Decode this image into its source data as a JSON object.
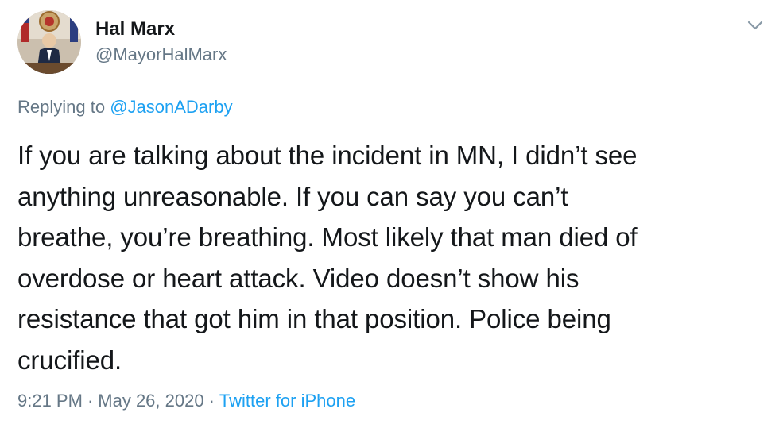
{
  "tweet": {
    "author": {
      "display_name": "Hal Marx",
      "handle": "@MayorHalMarx",
      "avatar_icon": "profile-photo"
    },
    "replying_to": {
      "prefix": "Replying to ",
      "handle": "@JasonADarby"
    },
    "text": "If you are talking about the incident in MN, I didn’t see\nanything unreasonable. If you can say you can’t\nbreathe, you’re breathing. Most likely that man died of\noverdose or heart attack. Video doesn’t show his\nresistance that got him in that position. Police being\ncrucified.",
    "time": "9:21 PM",
    "separator": "·",
    "date": "May 26, 2020",
    "source": "Twitter for iPhone",
    "menu_icon": "chevron-down-icon"
  },
  "colors": {
    "text": "#14171a",
    "secondary": "#657786",
    "link": "#1da1f2",
    "background": "#ffffff"
  }
}
